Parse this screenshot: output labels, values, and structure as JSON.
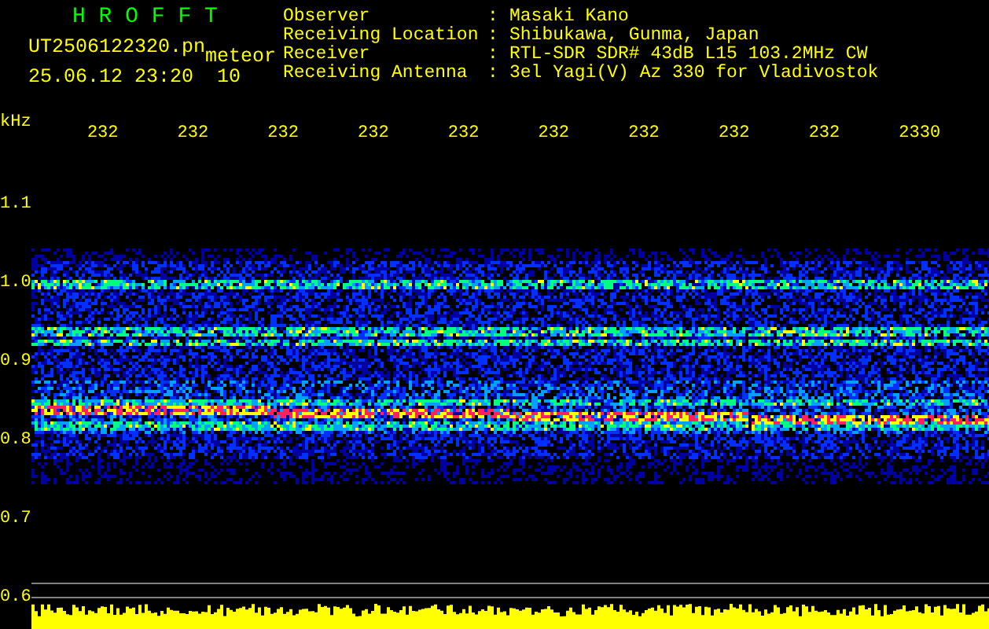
{
  "header": {
    "title": "H R O F F T",
    "file_name": "UT2506122320.pn",
    "mode": "meteor",
    "timestamp": "25.06.12 23:20",
    "interval": "10"
  },
  "info": [
    {
      "label": "Observer",
      "separator": ":",
      "value": "Masaki Kano"
    },
    {
      "label": "Receiving Location",
      "separator": ":",
      "value": "Shibukawa, Gunma, Japan"
    },
    {
      "label": "Receiver",
      "separator": ":",
      "value": "RTL-SDR SDR# 43dB L15 103.2MHz CW"
    },
    {
      "label": "Receiving Antenna",
      "separator": ":",
      "value": "3el Yagi(V) Az 330 for Vladivostok"
    }
  ],
  "time_axis": {
    "labels": [
      "232",
      "232",
      "232",
      "232",
      "232",
      "232",
      "232",
      "232",
      "232",
      "2330"
    ]
  },
  "frequency_axis": {
    "unit": "kHz",
    "labels": [
      "1.1",
      "1.0",
      "0.9",
      "0.8",
      "0.7",
      "0.6"
    ]
  }
}
